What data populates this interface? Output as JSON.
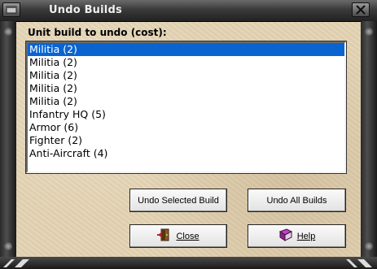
{
  "window": {
    "title": "Undo Builds"
  },
  "dialog": {
    "prompt": "Unit build to undo (cost):",
    "items": [
      {
        "label": "Militia (2)",
        "selected": true
      },
      {
        "label": "Militia (2)",
        "selected": false
      },
      {
        "label": "Militia (2)",
        "selected": false
      },
      {
        "label": "Militia (2)",
        "selected": false
      },
      {
        "label": "Militia (2)",
        "selected": false
      },
      {
        "label": "Infantry HQ (5)",
        "selected": false
      },
      {
        "label": "Armor (6)",
        "selected": false
      },
      {
        "label": "Fighter (2)",
        "selected": false
      },
      {
        "label": "Anti-Aircraft (4)",
        "selected": false
      }
    ]
  },
  "buttons": {
    "undo_selected": "Undo Selected Build",
    "undo_all": "Undo All Builds",
    "close": "Close",
    "help": "Help"
  },
  "icons": {
    "close": "close-door-icon",
    "help": "help-book-icon",
    "window_close": "close-icon",
    "system_menu": "window-menu-icon"
  },
  "colors": {
    "selection": "#0a64d0",
    "parchment": "#e3d3b3"
  }
}
